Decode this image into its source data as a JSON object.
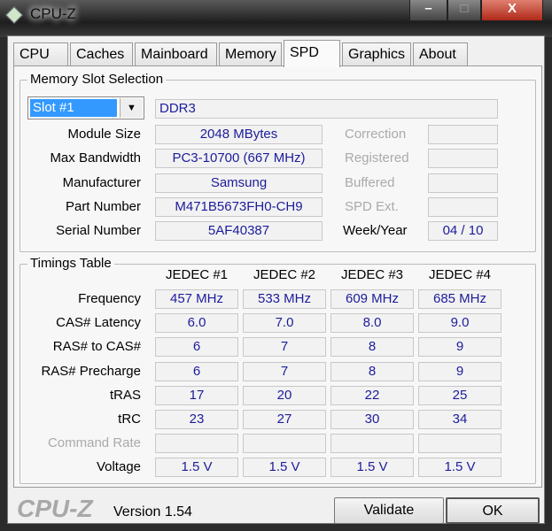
{
  "window": {
    "title": "CPU-Z",
    "minimize": "–",
    "maximize": "□",
    "close": "X"
  },
  "tabs": [
    "CPU",
    "Caches",
    "Mainboard",
    "Memory",
    "SPD",
    "Graphics",
    "About"
  ],
  "active_tab": "SPD",
  "slot": {
    "legend": "Memory Slot Selection",
    "selected": "Slot #1",
    "type": "DDR3",
    "rows": [
      {
        "label": "Module Size",
        "value": "2048 MBytes",
        "rlabel": "Correction",
        "rvalue": ""
      },
      {
        "label": "Max Bandwidth",
        "value": "PC3-10700 (667 MHz)",
        "rlabel": "Registered",
        "rvalue": ""
      },
      {
        "label": "Manufacturer",
        "value": "Samsung",
        "rlabel": "Buffered",
        "rvalue": ""
      },
      {
        "label": "Part Number",
        "value": "M471B5673FH0-CH9",
        "rlabel": "SPD Ext.",
        "rvalue": ""
      },
      {
        "label": "Serial Number",
        "value": "5AF40387",
        "rlabel": "Week/Year",
        "rvalue": "04 / 10"
      }
    ]
  },
  "timings": {
    "legend": "Timings Table",
    "headers": [
      "JEDEC #1",
      "JEDEC #2",
      "JEDEC #3",
      "JEDEC #4"
    ],
    "rows": [
      {
        "label": "Frequency",
        "values": [
          "457 MHz",
          "533 MHz",
          "609 MHz",
          "685 MHz"
        ]
      },
      {
        "label": "CAS# Latency",
        "values": [
          "6.0",
          "7.0",
          "8.0",
          "9.0"
        ]
      },
      {
        "label": "RAS# to CAS#",
        "values": [
          "6",
          "7",
          "8",
          "9"
        ]
      },
      {
        "label": "RAS# Precharge",
        "values": [
          "6",
          "7",
          "8",
          "9"
        ]
      },
      {
        "label": "tRAS",
        "values": [
          "17",
          "20",
          "22",
          "25"
        ]
      },
      {
        "label": "tRC",
        "values": [
          "23",
          "27",
          "30",
          "34"
        ]
      },
      {
        "label": "Command Rate",
        "values": [
          "",
          "",
          "",
          ""
        ]
      },
      {
        "label": "Voltage",
        "values": [
          "1.5 V",
          "1.5 V",
          "1.5 V",
          "1.5 V"
        ]
      }
    ]
  },
  "footer": {
    "logo": "CPU-Z",
    "version": "Version 1.54",
    "validate": "Validate",
    "ok": "OK"
  }
}
